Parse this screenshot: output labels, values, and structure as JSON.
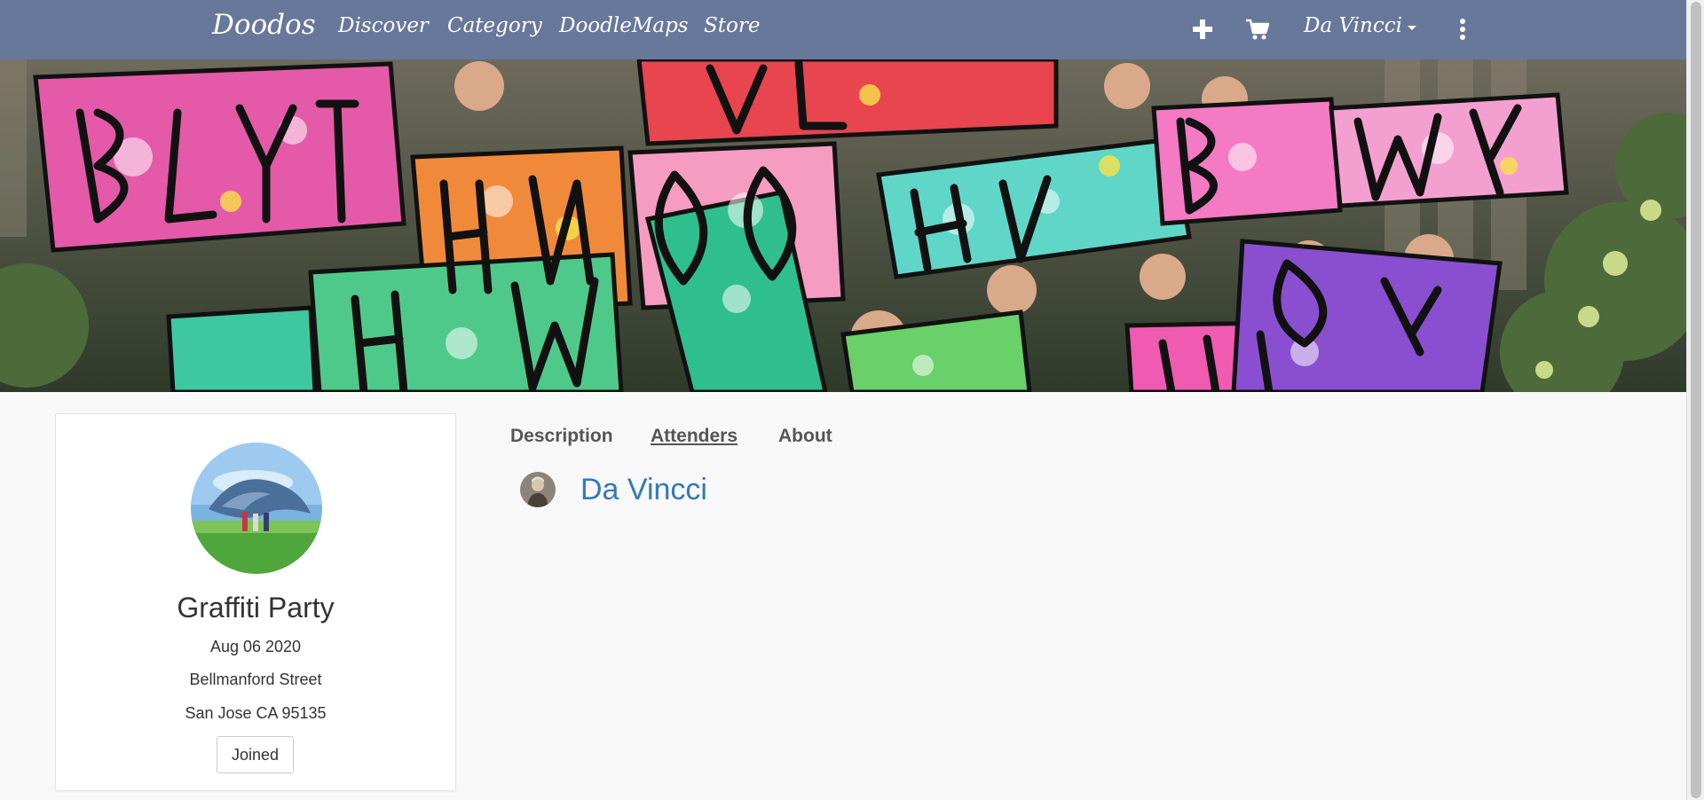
{
  "navbar": {
    "brand": "Doodos",
    "links": [
      "Discover",
      "Category",
      "DoodleMaps",
      "Store"
    ],
    "add_icon": "plus-icon",
    "cart_icon": "cart-icon",
    "more_icon": "vertical-ellipsis-icon",
    "user_name": "Da Vincci",
    "bg_color": "#68789b"
  },
  "event": {
    "title": "Graffiti Party",
    "date": "Aug 06 2020",
    "street": "Bellmanford Street",
    "city": "San Jose CA 95135",
    "join_label": "Joined"
  },
  "tabs": [
    {
      "label": "Description",
      "active": false
    },
    {
      "label": "Attenders",
      "active": true
    },
    {
      "label": "About",
      "active": false
    }
  ],
  "attenders": [
    {
      "name": "Da Vincci"
    }
  ],
  "colors": {
    "link": "#337ab7",
    "page_bg": "#f8f8f8"
  }
}
